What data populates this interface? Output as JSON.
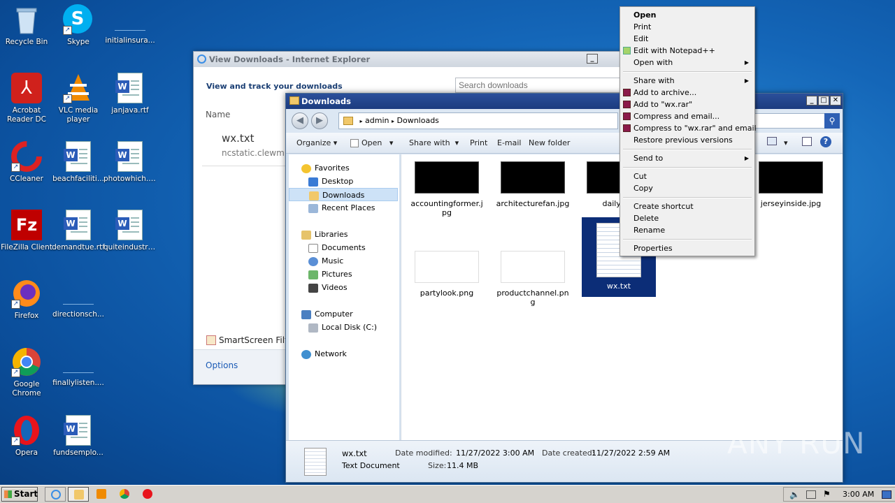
{
  "desktop": {
    "icons": [
      {
        "label": "Recycle Bin",
        "icon": "recycle-bin-icon"
      },
      {
        "label": "Skype",
        "icon": "skype-icon"
      },
      {
        "label": "initialinsura...",
        "icon": "blank-file-icon"
      },
      {
        "label": "Acrobat Reader DC",
        "icon": "acrobat-icon"
      },
      {
        "label": "VLC media player",
        "icon": "vlc-icon"
      },
      {
        "label": "janjava.rtf",
        "icon": "word-doc-icon"
      },
      {
        "label": "CCleaner",
        "icon": "ccleaner-icon"
      },
      {
        "label": "beachfaciliti...",
        "icon": "word-doc-icon"
      },
      {
        "label": "photowhich.rtf",
        "icon": "word-doc-icon"
      },
      {
        "label": "FileZilla Client",
        "icon": "filezilla-icon"
      },
      {
        "label": "demandtue.rtf",
        "icon": "word-doc-icon"
      },
      {
        "label": "quiteindustri...",
        "icon": "word-doc-icon"
      },
      {
        "label": "Firefox",
        "icon": "firefox-icon"
      },
      {
        "label": "directionsch...",
        "icon": "blank-file-icon"
      },
      {
        "label": "Google Chrome",
        "icon": "chrome-icon"
      },
      {
        "label": "finallylisten....",
        "icon": "blank-file-icon"
      },
      {
        "label": "Opera",
        "icon": "opera-icon"
      },
      {
        "label": "fundsemplo...",
        "icon": "word-doc-icon"
      }
    ]
  },
  "ie": {
    "title": "View Downloads - Internet Explorer",
    "heading": "View and track your downloads",
    "search_placeholder": "Search downloads",
    "name_col": "Name",
    "file_name": "wx.txt",
    "file_source": "ncstatic.clewm.n",
    "smartscreen": "SmartScreen Filte",
    "options": "Options"
  },
  "explorer": {
    "title": "Downloads",
    "breadcrumb": [
      "admin",
      "Downloads"
    ],
    "toolbar": {
      "organize": "Organize",
      "open": "Open",
      "share_with": "Share with",
      "print": "Print",
      "email": "E-mail",
      "new_folder": "New folder"
    },
    "nav": {
      "favorites": "Favorites",
      "desktop": "Desktop",
      "downloads": "Downloads",
      "recent_places": "Recent Places",
      "libraries": "Libraries",
      "documents": "Documents",
      "music": "Music",
      "pictures": "Pictures",
      "videos": "Videos",
      "computer": "Computer",
      "local_disk": "Local Disk (C:)",
      "network": "Network"
    },
    "files": [
      {
        "name": "accountingformer.jpg",
        "thumb": "dark"
      },
      {
        "name": "architecturefan.jpg",
        "thumb": "dark"
      },
      {
        "name": "dailypap",
        "thumb": "dark"
      },
      {
        "name": "jerseyinside.jpg",
        "thumb": "dark"
      },
      {
        "name": "partylook.png",
        "thumb": "light"
      },
      {
        "name": "productchannel.png",
        "thumb": "light"
      },
      {
        "name": "wx.txt",
        "thumb": "text",
        "selected": true
      }
    ],
    "status": {
      "file_name": "wx.txt",
      "file_type": "Text Document",
      "date_modified_label": "Date modified:",
      "date_modified": "11/27/2022 3:00 AM",
      "date_created_label": "Date created:",
      "date_created": "11/27/2022 2:59 AM",
      "size_label": "Size:",
      "size": "11.4 MB"
    }
  },
  "context_menu": {
    "items": [
      "Open",
      "Print",
      "Edit",
      "Edit with Notepad++",
      "Open with",
      "Share with",
      "Add to archive...",
      "Add to \"wx.rar\"",
      "Compress and email...",
      "Compress to \"wx.rar\" and email",
      "Restore previous versions",
      "Send to",
      "Cut",
      "Copy",
      "Create shortcut",
      "Delete",
      "Rename",
      "Properties"
    ]
  },
  "taskbar": {
    "start": "Start",
    "clock": "3:00 AM"
  },
  "watermark": "ANY RUN"
}
